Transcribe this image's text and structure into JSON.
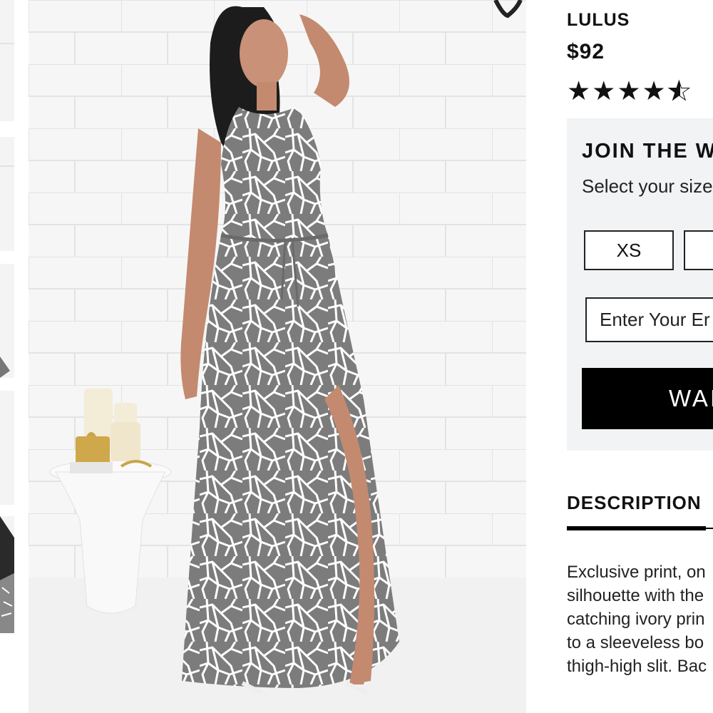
{
  "product": {
    "brand": "LULUS",
    "price": "$92",
    "rating": 4.5,
    "stars_full": "★★★★",
    "star_glyph": "★"
  },
  "waitlist": {
    "title": "JOIN THE W",
    "subtitle": "Select your size",
    "sizes": [
      "XS",
      ""
    ],
    "email_placeholder": "Enter Your Er",
    "button_label": "WAI"
  },
  "description": {
    "heading": "DESCRIPTION",
    "lines": [
      "Exclusive print, on",
      "silhouette with the",
      "catching ivory prin",
      "to a sleeveless bo",
      "thigh-high slit. Bac"
    ]
  },
  "colors": {
    "panel_bg": "#f2f3f4",
    "accent": "#000000",
    "dress_gray": "#7a7a7a"
  }
}
